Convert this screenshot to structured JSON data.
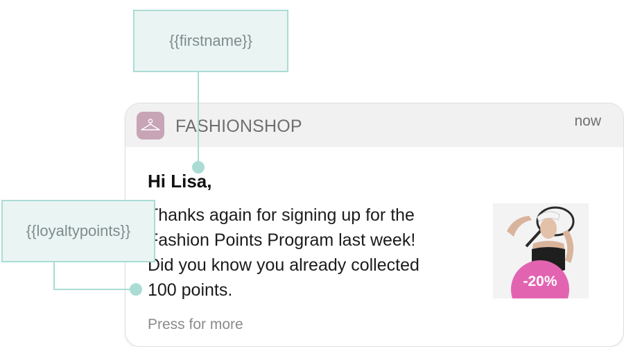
{
  "notification": {
    "app_name": "FASHIONSHOP",
    "app_icon": "hanger-icon",
    "time": "now",
    "greeting": "Hi Lisa,",
    "message_lines": [
      "Thanks again for signing up for the",
      "Fashion Points Program last week!",
      "Did you know you already collected",
      "100 points."
    ],
    "footer": "Press for more",
    "badge": "-20%"
  },
  "variables": {
    "firstname": "{{firstname}}",
    "loyaltypoints": "{{loyaltypoints}}"
  },
  "colors": {
    "accent_teal": "#aadcd4",
    "tag_background": "#eaf5f3",
    "app_icon_bg": "#c7a4b6",
    "badge_pink": "#e264b1",
    "header_bg": "#f1f1f1"
  }
}
